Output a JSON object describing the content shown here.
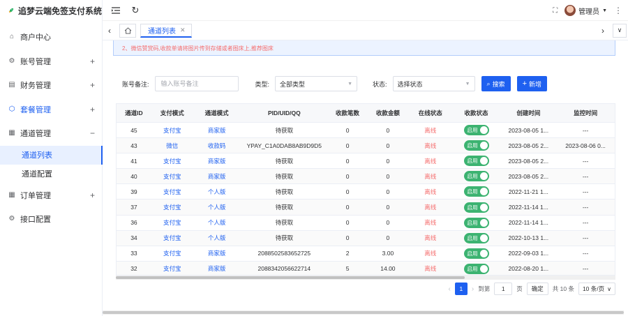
{
  "app": {
    "title": "追梦云端免签支付系统"
  },
  "sidebar": {
    "items": [
      {
        "label": "商户中心",
        "icon": "home-icon",
        "expandable": false
      },
      {
        "label": "账号管理",
        "icon": "settings-icon",
        "expandable": true
      },
      {
        "label": "财务管理",
        "icon": "finance-icon",
        "expandable": true
      },
      {
        "label": "套餐管理",
        "icon": "package-icon",
        "expandable": true
      },
      {
        "label": "通道管理",
        "icon": "channel-icon",
        "expandable": true,
        "expanded": true,
        "children": [
          {
            "label": "通道列表",
            "active": true
          },
          {
            "label": "通道配置"
          }
        ]
      },
      {
        "label": "订单管理",
        "icon": "order-icon",
        "expandable": true
      },
      {
        "label": "接口配置",
        "icon": "api-icon",
        "expandable": false
      }
    ],
    "plus": "+",
    "minus": "−"
  },
  "header": {
    "user": "管理员"
  },
  "tabs": {
    "active": "通道列表"
  },
  "notice": "2、微信赞赏码,收款单请将图片传到存储或者图床上,推荐图床",
  "filters": {
    "remark_label": "账号备注:",
    "remark_placeholder": "输入账号备注",
    "type_label": "类型:",
    "type_value": "全部类型",
    "status_label": "状态:",
    "status_value": "选择状态",
    "search_label": "搜索",
    "add_label": "新增"
  },
  "table": {
    "headers": [
      "通道ID",
      "支付模式",
      "通道模式",
      "PID/UID/QQ",
      "收款笔数",
      "收款金额",
      "在线状态",
      "收款状态",
      "创建时间",
      "监控时间"
    ],
    "rows": [
      [
        "45",
        "支付宝",
        "商家版",
        "待获取",
        "0",
        "0",
        "离线",
        "启用",
        "2023-08-05 1...",
        "---"
      ],
      [
        "43",
        "微信",
        "收款码",
        "YPAY_C1A0DAB8AB9D9D5",
        "0",
        "0",
        "离线",
        "启用",
        "2023-08-05 2...",
        "2023-08-06 0..."
      ],
      [
        "41",
        "支付宝",
        "商家版",
        "待获取",
        "0",
        "0",
        "离线",
        "启用",
        "2023-08-05 2...",
        "---"
      ],
      [
        "40",
        "支付宝",
        "商家版",
        "待获取",
        "0",
        "0",
        "离线",
        "启用",
        "2023-08-05 2...",
        "---"
      ],
      [
        "39",
        "支付宝",
        "个人版",
        "待获取",
        "0",
        "0",
        "离线",
        "启用",
        "2022-11-21 1...",
        "---"
      ],
      [
        "37",
        "支付宝",
        "个人版",
        "待获取",
        "0",
        "0",
        "离线",
        "启用",
        "2022-11-14 1...",
        "---"
      ],
      [
        "36",
        "支付宝",
        "个人版",
        "待获取",
        "0",
        "0",
        "离线",
        "启用",
        "2022-11-14 1...",
        "---"
      ],
      [
        "34",
        "支付宝",
        "个人版",
        "待获取",
        "0",
        "0",
        "离线",
        "启用",
        "2022-10-13 1...",
        "---"
      ],
      [
        "33",
        "支付宝",
        "商家版",
        "2088502583652725",
        "2",
        "3.00",
        "离线",
        "启用",
        "2022-09-03 1...",
        "---"
      ],
      [
        "32",
        "支付宝",
        "商家版",
        "2088342056622714",
        "5",
        "14.00",
        "离线",
        "启用",
        "2022-08-20 1...",
        "---"
      ]
    ]
  },
  "pagination": {
    "current": "1",
    "goto_label": "到第",
    "goto_value": "1",
    "page_suffix": "页",
    "confirm_label": "确定",
    "total": "共 10 条",
    "page_size": "10 条/页"
  },
  "colors": {
    "primary": "#1e60f0",
    "danger": "#f56c6c",
    "success": "#3cb371"
  }
}
